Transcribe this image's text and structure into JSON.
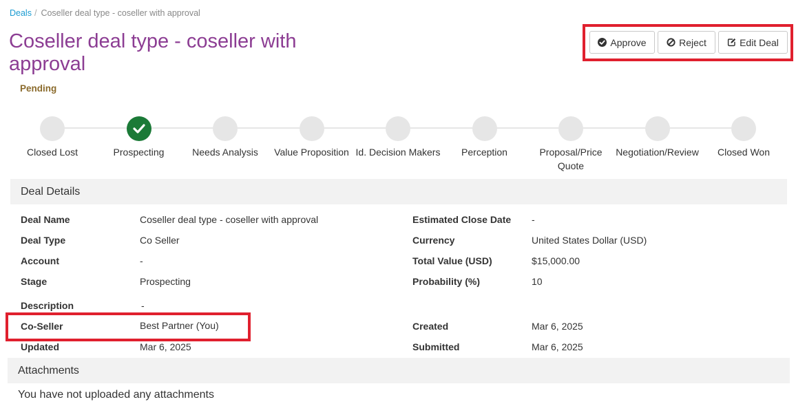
{
  "breadcrumb": {
    "parent": "Deals",
    "separator": "/",
    "current": "Coseller deal type - coseller with approval"
  },
  "deal": {
    "title": "Coseller deal type - coseller with approval",
    "status": "Pending"
  },
  "actions": {
    "approve": "Approve",
    "reject": "Reject",
    "edit": "Edit Deal"
  },
  "stages": [
    {
      "label": "Closed Lost",
      "completed": false
    },
    {
      "label": "Prospecting",
      "completed": true
    },
    {
      "label": "Needs Analysis",
      "completed": false
    },
    {
      "label": "Value Proposition",
      "completed": false
    },
    {
      "label": "Id. Decision Makers",
      "completed": false
    },
    {
      "label": "Perception",
      "completed": false
    },
    {
      "label": "Proposal/Price Quote",
      "completed": false
    },
    {
      "label": "Negotiation/Review",
      "completed": false
    },
    {
      "label": "Closed Won",
      "completed": false
    }
  ],
  "details": {
    "heading": "Deal Details",
    "deal_name_label": "Deal Name",
    "deal_name": "Coseller deal type - coseller with approval",
    "deal_type_label": "Deal Type",
    "deal_type": "Co Seller",
    "account_label": "Account",
    "account": "-",
    "stage_label": "Stage",
    "stage": "Prospecting",
    "description_label": "Description",
    "description": "-",
    "coseller_label": "Co-Seller",
    "coseller": "Best Partner (You)",
    "updated_label": "Updated",
    "updated": "Mar 6, 2025",
    "close_date_label": "Estimated Close Date",
    "close_date": "-",
    "currency_label": "Currency",
    "currency": "United States Dollar (USD)",
    "total_value_label": "Total Value (USD)",
    "total_value": "$15,000.00",
    "probability_label": "Probability (%)",
    "probability": "10",
    "created_label": "Created",
    "created": "Mar 6, 2025",
    "submitted_label": "Submitted",
    "submitted": "Mar 6, 2025"
  },
  "attachments": {
    "heading": "Attachments",
    "empty_message": "You have not uploaded any attachments"
  },
  "colors": {
    "title": "#8c3d93",
    "status": "#8a6a2b",
    "stage_done": "#1b7a37",
    "stage_pending": "#e6e6e6",
    "highlight": "#e0202e",
    "link": "#1a9bd1"
  }
}
